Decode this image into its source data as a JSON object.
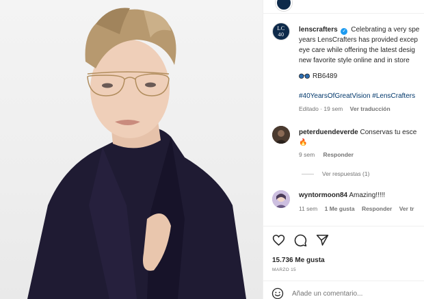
{
  "post": {
    "author": "lenscrafters",
    "caption_lines": [
      "Celebrating a very spe",
      "years LensCrafters has provided excep",
      "eye care while offering the latest desig",
      "new favorite style online and in store"
    ],
    "brand_avatar_top": "LC",
    "brand_avatar_bottom": "40",
    "sku": "RB6489",
    "hashtags": "#40YearsOfGreatVision #LensCrafters",
    "edited_meta": "Editado · 19 sem",
    "translate": "Ver traducción"
  },
  "comments": [
    {
      "user": "peterduendeverde",
      "text": "Conservas tu esce",
      "emoji": "🔥",
      "age": "9 sem",
      "reply": "Responder",
      "replies_label": "Ver respuestas (1)"
    },
    {
      "user": "wyntormoon84",
      "text": "Amazing!!!!!",
      "age": "11 sem",
      "likes": "1 Me gusta",
      "reply": "Responder",
      "translate": "Ver tr"
    }
  ],
  "stats": {
    "likes": "15.736 Me gusta",
    "date": "MARZO 15"
  },
  "composer": {
    "placeholder": "Añade un comentario..."
  },
  "icons": {
    "like": "heart-icon",
    "comment": "comment-icon",
    "share": "share-icon",
    "emoji": "emoji-icon",
    "verified": "verified-badge-icon",
    "glasses": "glasses-emoji-icon"
  },
  "colors": {
    "link": "#00376b",
    "secondary": "#737373",
    "verified": "#1d9bf0",
    "brand": "#0e2a4a"
  }
}
